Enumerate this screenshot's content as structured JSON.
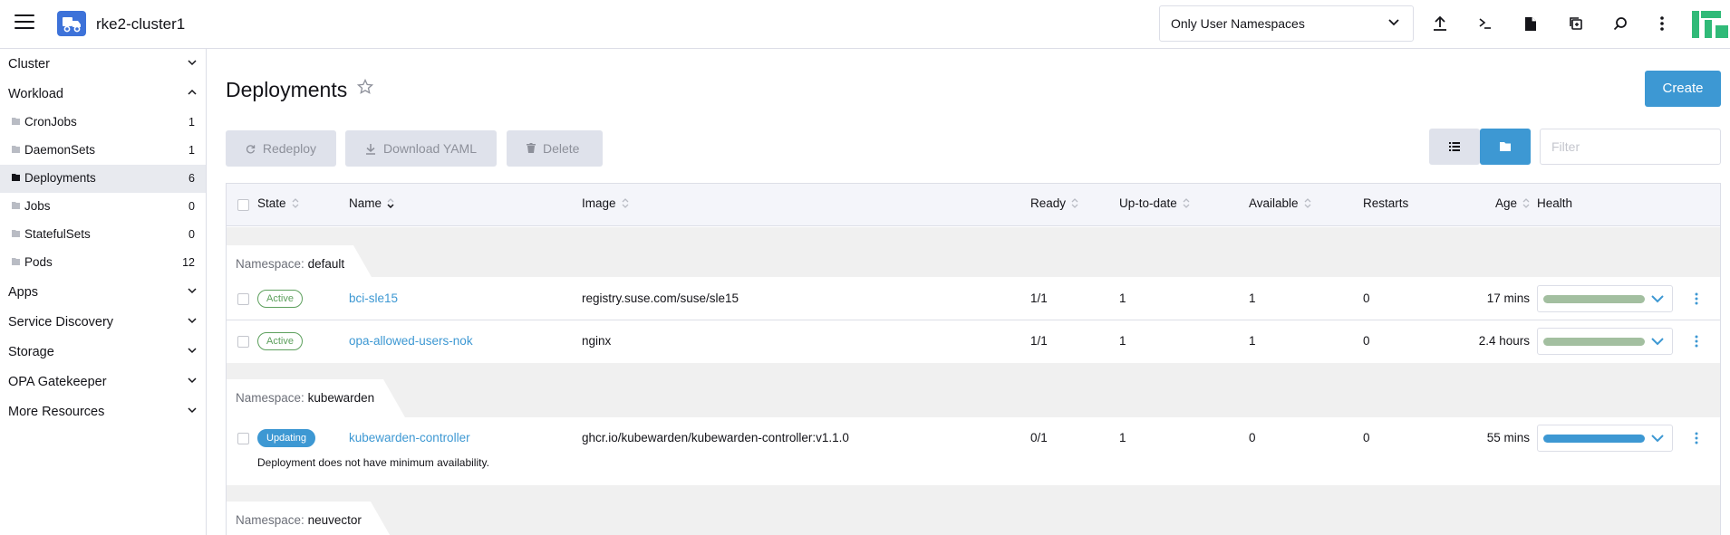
{
  "header": {
    "cluster_name": "rke2-cluster1",
    "namespace_filter": "Only User Namespaces",
    "icons": [
      "upload-icon",
      "terminal-icon",
      "file-icon",
      "copy-config-icon",
      "search-icon",
      "more-vertical-icon"
    ]
  },
  "sidebar": {
    "groups": [
      {
        "label": "Cluster"
      },
      {
        "label": "Workload"
      },
      {
        "label": "Apps"
      },
      {
        "label": "Service Discovery"
      },
      {
        "label": "Storage"
      },
      {
        "label": "OPA Gatekeeper"
      },
      {
        "label": "More Resources"
      }
    ],
    "workload_items": [
      {
        "label": "CronJobs",
        "count": "1"
      },
      {
        "label": "DaemonSets",
        "count": "1"
      },
      {
        "label": "Deployments",
        "count": "6"
      },
      {
        "label": "Jobs",
        "count": "0"
      },
      {
        "label": "StatefulSets",
        "count": "0"
      },
      {
        "label": "Pods",
        "count": "12"
      }
    ]
  },
  "page": {
    "title": "Deployments",
    "create_label": "Create",
    "redeploy_label": "Redeploy",
    "download_label": "Download YAML",
    "delete_label": "Delete",
    "filter_placeholder": "Filter"
  },
  "table": {
    "columns": {
      "state": "State",
      "name": "Name",
      "image": "Image",
      "ready": "Ready",
      "uptodate": "Up-to-date",
      "available": "Available",
      "restarts": "Restarts",
      "age": "Age",
      "health": "Health"
    },
    "namespace_label": "Namespace:",
    "groups": [
      {
        "namespace": "default",
        "rows": [
          {
            "state": "Active",
            "name": "bci-sle15",
            "image": "registry.suse.com/suse/sle15",
            "ready": "1/1",
            "uptodate": "1",
            "available": "1",
            "restarts": "0",
            "age": "17 mins",
            "health_color": "#a3bfa0",
            "health": 1.0
          },
          {
            "state": "Active",
            "name": "opa-allowed-users-nok",
            "image": "nginx",
            "ready": "1/1",
            "uptodate": "1",
            "available": "1",
            "restarts": "0",
            "age": "2.4 hours",
            "health_color": "#a3bfa0",
            "health": 1.0
          }
        ]
      },
      {
        "namespace": "kubewarden",
        "rows": [
          {
            "state": "Updating",
            "name": "kubewarden-controller",
            "image": "ghcr.io/kubewarden/kubewarden-controller:v1.1.0",
            "ready": "0/1",
            "uptodate": "1",
            "available": "0",
            "restarts": "0",
            "age": "55 mins",
            "health_color": "#3d98d3",
            "health": 1.0,
            "description": "Deployment does not have minimum availability."
          }
        ]
      },
      {
        "namespace": "neuvector",
        "rows": []
      }
    ]
  }
}
